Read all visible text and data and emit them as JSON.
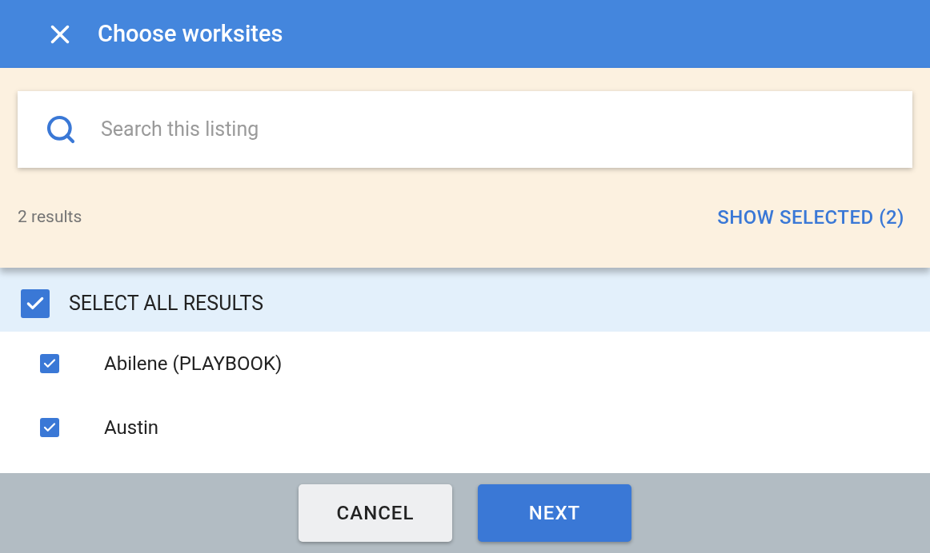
{
  "header": {
    "title": "Choose worksites"
  },
  "search": {
    "placeholder": "Search this listing"
  },
  "results_count": "2 results",
  "show_selected": "SHOW SELECTED (2)",
  "select_all": {
    "label": "SELECT ALL RESULTS",
    "checked": true
  },
  "items": [
    {
      "label": "Abilene (PLAYBOOK)",
      "checked": true
    },
    {
      "label": "Austin",
      "checked": true
    }
  ],
  "buttons": [
    {
      "label": "CANCEL",
      "kind": "secondary"
    },
    {
      "label": "NEXT",
      "kind": "primary"
    }
  ]
}
